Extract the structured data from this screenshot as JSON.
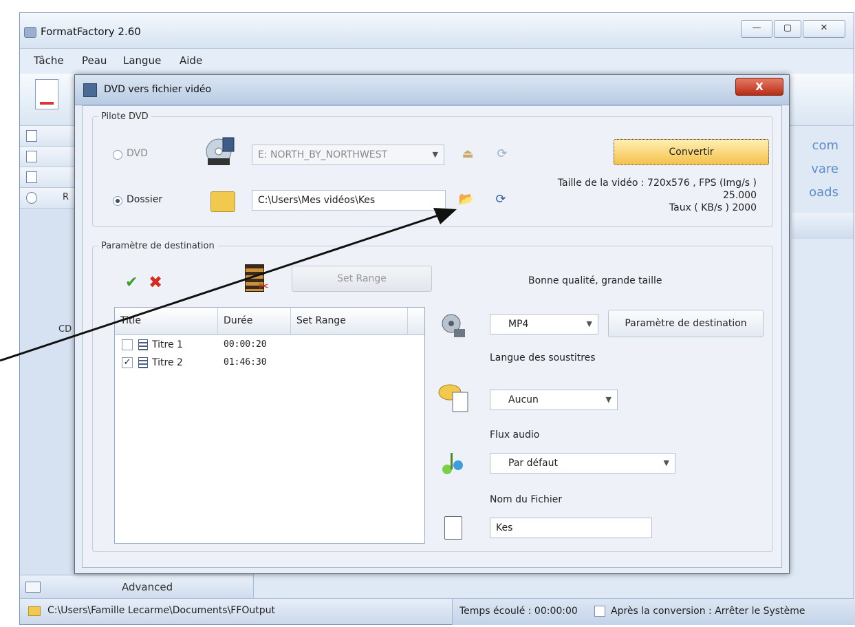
{
  "main_window": {
    "title": "FormatFactory 2.60",
    "controls": {
      "minimize": "—",
      "maximize": "▢",
      "close": "✕"
    },
    "menu": [
      "Tâche",
      "Peau",
      "Langue",
      "Aide"
    ],
    "left_panel": {
      "row_label_partial": "R",
      "cd_label_partial": "CD",
      "advanced": "Advanced"
    },
    "right_links": [
      "com",
      "vare",
      "oads"
    ],
    "status": {
      "output_path": "C:\\Users\\Famille Lecarme\\Documents\\FFOutput",
      "elapsed": "Temps écoulé : 00:00:00",
      "after_conversion": "Après la conversion : Arrêter le Système"
    }
  },
  "dialog": {
    "title": "DVD vers fichier vidéo",
    "close_label": "X",
    "source_group": {
      "legend": "Pilote DVD",
      "dvd_label": "DVD",
      "dvd_drive": "E:  NORTH_BY_NORTHWEST",
      "folder_label": "Dossier",
      "folder_path": "C:\\Users\\Mes vidéos\\Kes",
      "selected": "Dossier"
    },
    "convert_label": "Convertir",
    "video_info": {
      "line1": "Taille de la vidéo : 720x576 , FPS (Img/s )",
      "fps": "25.000",
      "rate": "Taux ( KB/s )  2000"
    },
    "dest_group": {
      "legend": "Paramètre de destination",
      "set_range": "Set Range",
      "quality": "Bonne qualité, grande taille",
      "columns": [
        "Title",
        "Durée",
        "Set Range"
      ],
      "rows": [
        {
          "checked": false,
          "title": "Titre 1",
          "duration": "00:00:20",
          "range": ""
        },
        {
          "checked": true,
          "title": "Titre 2",
          "duration": "01:46:30",
          "range": ""
        }
      ],
      "format": "MP4",
      "param_button": "Paramètre de destination",
      "subtitle_label": "Langue des soustitres",
      "subtitle_value": "Aucun",
      "audio_label": "Flux audio",
      "audio_value": "Par défaut",
      "filename_label": "Nom du Fichier",
      "filename_value": "Kes"
    }
  },
  "colors": {
    "accent_convert": "#f5c04a",
    "close_red": "#b82d16",
    "ok_green": "#3e9d2a",
    "cancel_red": "#d42c1e"
  }
}
